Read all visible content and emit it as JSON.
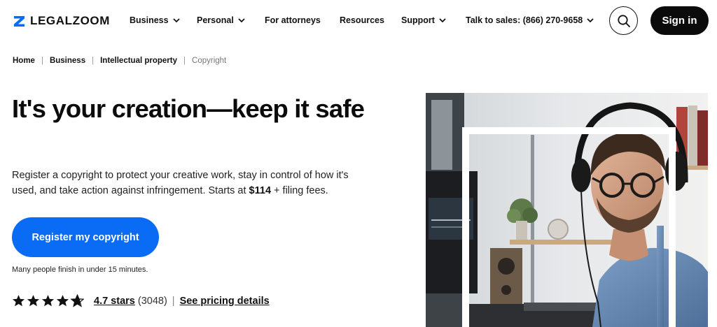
{
  "brand": {
    "name": "LEGALZOOM",
    "accent": "#0a6cf5"
  },
  "nav": {
    "items": [
      {
        "label": "Business",
        "has_dropdown": true
      },
      {
        "label": "Personal",
        "has_dropdown": true
      },
      {
        "label": "For attorneys",
        "has_dropdown": false
      },
      {
        "label": "Resources",
        "has_dropdown": false
      },
      {
        "label": "Support",
        "has_dropdown": true
      },
      {
        "label": "Talk to sales: (866) 270-9658",
        "has_dropdown": true
      }
    ],
    "search_icon": "search-icon",
    "signin_label": "Sign in"
  },
  "breadcrumb": {
    "items": [
      "Home",
      "Business",
      "Intellectual property"
    ],
    "current": "Copyright"
  },
  "hero": {
    "title": "It's your creation—keep it safe",
    "description_pre": "Register a copyright to protect your creative work, stay in control of how it's used, and take action against infringement. Starts at ",
    "price": "$114",
    "description_post": " + filing fees.",
    "cta_label": "Register my copyright",
    "finish_note": "Many people finish in under 15 minutes."
  },
  "rating": {
    "stars_value": 4.7,
    "stars_text": "4.7 stars",
    "count": "(3048)",
    "separator": "|",
    "pricing_link": "See pricing details"
  }
}
